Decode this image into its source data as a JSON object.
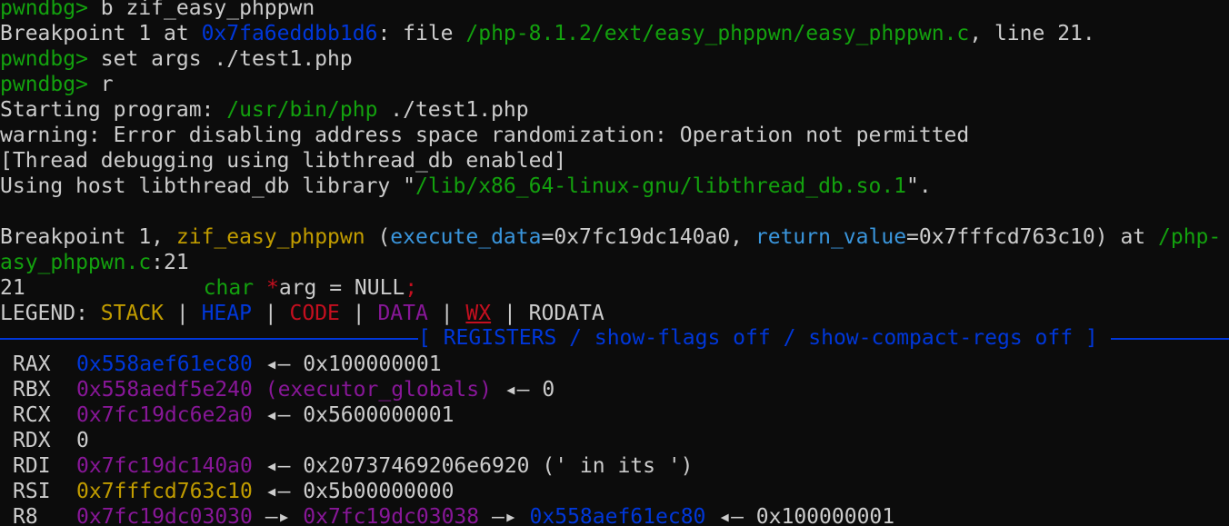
{
  "cmd1": {
    "prompt": "pwndbg>",
    "command": " b zif_easy_phppwn"
  },
  "bp_info": {
    "prefix": "Breakpoint 1 at ",
    "addr": "0x7fa6eddbb1d6",
    "mid": ": file ",
    "path": "/php-8.1.2/ext/easy_phppwn/easy_phppwn.c",
    "suffix": ", line 21."
  },
  "cmd2": {
    "prompt": "pwndbg>",
    "command": " set args ./test1.php"
  },
  "cmd3": {
    "prompt": "pwndbg>",
    "command": " r"
  },
  "starting": {
    "prefix": "Starting program: ",
    "path": "/usr/bin/php",
    "suffix": " ./test1.php"
  },
  "warning": "warning: Error disabling address space randomization: Operation not permitted",
  "thread_debug": "[Thread debugging using libthread_db enabled]",
  "host_lib": {
    "prefix": "Using host libthread_db library \"",
    "path": "/lib/x86_64-linux-gnu/libthread_db.so.1",
    "suffix": "\"."
  },
  "bp_hit": {
    "prefix": "Breakpoint 1, ",
    "func": "zif_easy_phppwn",
    "open": " (",
    "param1": "execute_data",
    "val1": "=0x7fc19dc140a0, ",
    "param2": "return_value",
    "val2": "=0x7fffcd763c10) at ",
    "path": "/php-",
    "path2": "asy_phppwn.c",
    "line": ":21"
  },
  "source_line": {
    "num": "21",
    "type": "char",
    "star": "*",
    "rest": "arg = NULL",
    "semi": ";"
  },
  "legend": {
    "label": "LEGEND: ",
    "stack": "STACK",
    "heap": "HEAP",
    "code": "CODE",
    "data": "DATA",
    "wx": "WX",
    "rodata": "RODATA",
    "divider": " | "
  },
  "registers_header": "[ REGISTERS / show-flags off / show-compact-regs off ]",
  "registers": {
    "rax": {
      "name": "RAX",
      "addr": "0x558aef61ec80",
      "arrow": " ◂— ",
      "value": "0x100000001"
    },
    "rbx": {
      "name": "RBX",
      "addr": "0x558aedf5e240",
      "sym": " (executor_globals)",
      "arrow": " ◂— ",
      "value": "0"
    },
    "rcx": {
      "name": "RCX",
      "addr": "0x7fc19dc6e2a0",
      "arrow": " ◂— ",
      "value": "0x5600000001"
    },
    "rdx": {
      "name": "RDX",
      "value": "0"
    },
    "rdi": {
      "name": "RDI",
      "addr": "0x7fc19dc140a0",
      "arrow": " ◂— ",
      "value": "0x20737469206e6920 (' in its ')"
    },
    "rsi": {
      "name": "RSI",
      "addr": "0x7fffcd763c10",
      "arrow": " ◂— ",
      "value": "0x5b00000000"
    },
    "r8": {
      "name": "R8",
      "addr": "0x7fc19dc03030",
      "arrow1": " —▸ ",
      "addr2": "0x7fc19dc03038",
      "arrow2": " —▸ ",
      "addr3": "0x558aef61ec80",
      "arrow3": " ◂— ",
      "value": "0x100000001"
    }
  },
  "colors": {
    "background": "#0c0c0c",
    "foreground": "#cccccc",
    "green": "#13a10e",
    "blue": "#0037da",
    "cyan": "#3a96dd",
    "yellow": "#c19c00",
    "magenta": "#881798",
    "red": "#c50f1f"
  }
}
